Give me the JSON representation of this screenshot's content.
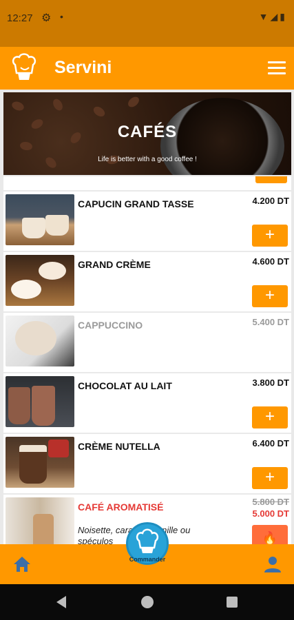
{
  "status_bar": {
    "time": "12:27",
    "icons": [
      "gear-icon",
      "dot-icon",
      "wifi-icon",
      "signal-icon",
      "battery-icon"
    ]
  },
  "app_bar": {
    "title": "Servini",
    "logo_icon": "chef-hat-logo-icon",
    "menu_icon": "hamburger-menu-icon"
  },
  "banner": {
    "title": "CAFÉS",
    "subtitle": "Life is better with a good coffee !"
  },
  "products": [
    {
      "name": "CAPUCIN GRAND TASSE",
      "price": "4.200 DT",
      "add_label": "+",
      "available": true
    },
    {
      "name": "GRAND CRÈME",
      "price": "4.600 DT",
      "add_label": "+",
      "available": true
    },
    {
      "name": "CAPPUCCINO",
      "price": "5.400 DT",
      "available": false
    },
    {
      "name": "CHOCOLAT AU LAIT",
      "price": "3.800 DT",
      "add_label": "+",
      "available": true
    },
    {
      "name": "CRÈME NUTELLA",
      "price": "6.400 DT",
      "add_label": "+",
      "available": true
    }
  ],
  "promo_product": {
    "name": "CAFÉ AROMATISÉ",
    "old_price": "5.800 DT",
    "new_price": "5.000 DT",
    "description": "Noisette, caramel, vanille ou spéculos",
    "badge_icon": "fire-icon"
  },
  "bottom_nav": {
    "home_icon": "home-icon",
    "profile_icon": "person-icon",
    "fab_icon": "chef-hat-icon",
    "fab_label": "Commander"
  },
  "colors": {
    "primary": "#ff9800",
    "status_bar": "#cc7a00",
    "promo_red": "#e53935",
    "fab_blue": "#29a3d8"
  }
}
